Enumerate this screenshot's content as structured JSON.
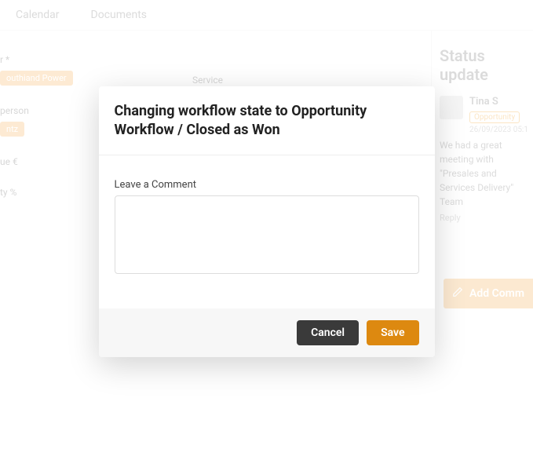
{
  "tabs": {
    "calendar": "Calendar",
    "documents": "Documents"
  },
  "fields": {
    "customer": "r *",
    "customer_value": "outhiand Power",
    "sales_person": "person",
    "sales_person_value": "ntz",
    "contract_value": "ue €",
    "probability": "ty %",
    "service": "Service"
  },
  "sidebar": {
    "title": "Status update",
    "user": "Tina S",
    "badge": "Opportunity",
    "timestamp": "26/09/2023 05:1",
    "body": "We had a great meeting with \"Presales and Services Delivery\" Team",
    "reply": "Reply",
    "add_btn": "Add Comm"
  },
  "modal": {
    "title": "Changing workflow state to Opportunity Workflow / Closed as Won",
    "comment_label": "Leave a Comment",
    "comment_value": "",
    "cancel": "Cancel",
    "save": "Save"
  }
}
